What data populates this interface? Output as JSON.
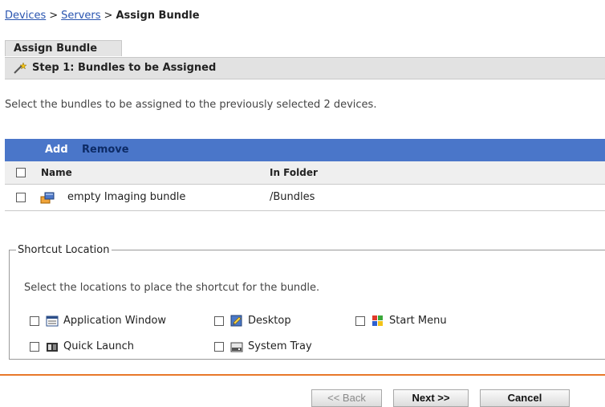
{
  "breadcrumb": {
    "items": [
      "Devices",
      "Servers"
    ],
    "separator": ">",
    "current": "Assign Bundle"
  },
  "tab": {
    "label": "Assign Bundle"
  },
  "step": {
    "label": "Step 1: Bundles to be Assigned",
    "icon": "wizard-wand-icon"
  },
  "intro": "Select the bundles to be assigned to the previously selected 2 devices.",
  "table": {
    "actions": {
      "add": "Add",
      "remove": "Remove"
    },
    "columns": {
      "name": "Name",
      "folder": "In Folder"
    },
    "rows": [
      {
        "name": "empty Imaging bundle",
        "folder": "/Bundles",
        "icon": "bundle-icon",
        "checked": false
      }
    ],
    "header_color": "#4a76c9"
  },
  "shortcut": {
    "legend": "Shortcut Location",
    "description": "Select the locations to place the shortcut for the bundle.",
    "options": [
      {
        "label": "Application Window",
        "icon": "application-window-icon",
        "checked": false
      },
      {
        "label": "Desktop",
        "icon": "desktop-icon",
        "checked": false
      },
      {
        "label": "Start Menu",
        "icon": "start-menu-icon",
        "checked": false
      },
      {
        "label": "Quick Launch",
        "icon": "quick-launch-icon",
        "checked": false
      },
      {
        "label": "System Tray",
        "icon": "system-tray-icon",
        "checked": false
      }
    ]
  },
  "buttons": {
    "back": "<< Back",
    "next": "Next >>",
    "cancel": "Cancel"
  },
  "accent_color": "#e8782a"
}
